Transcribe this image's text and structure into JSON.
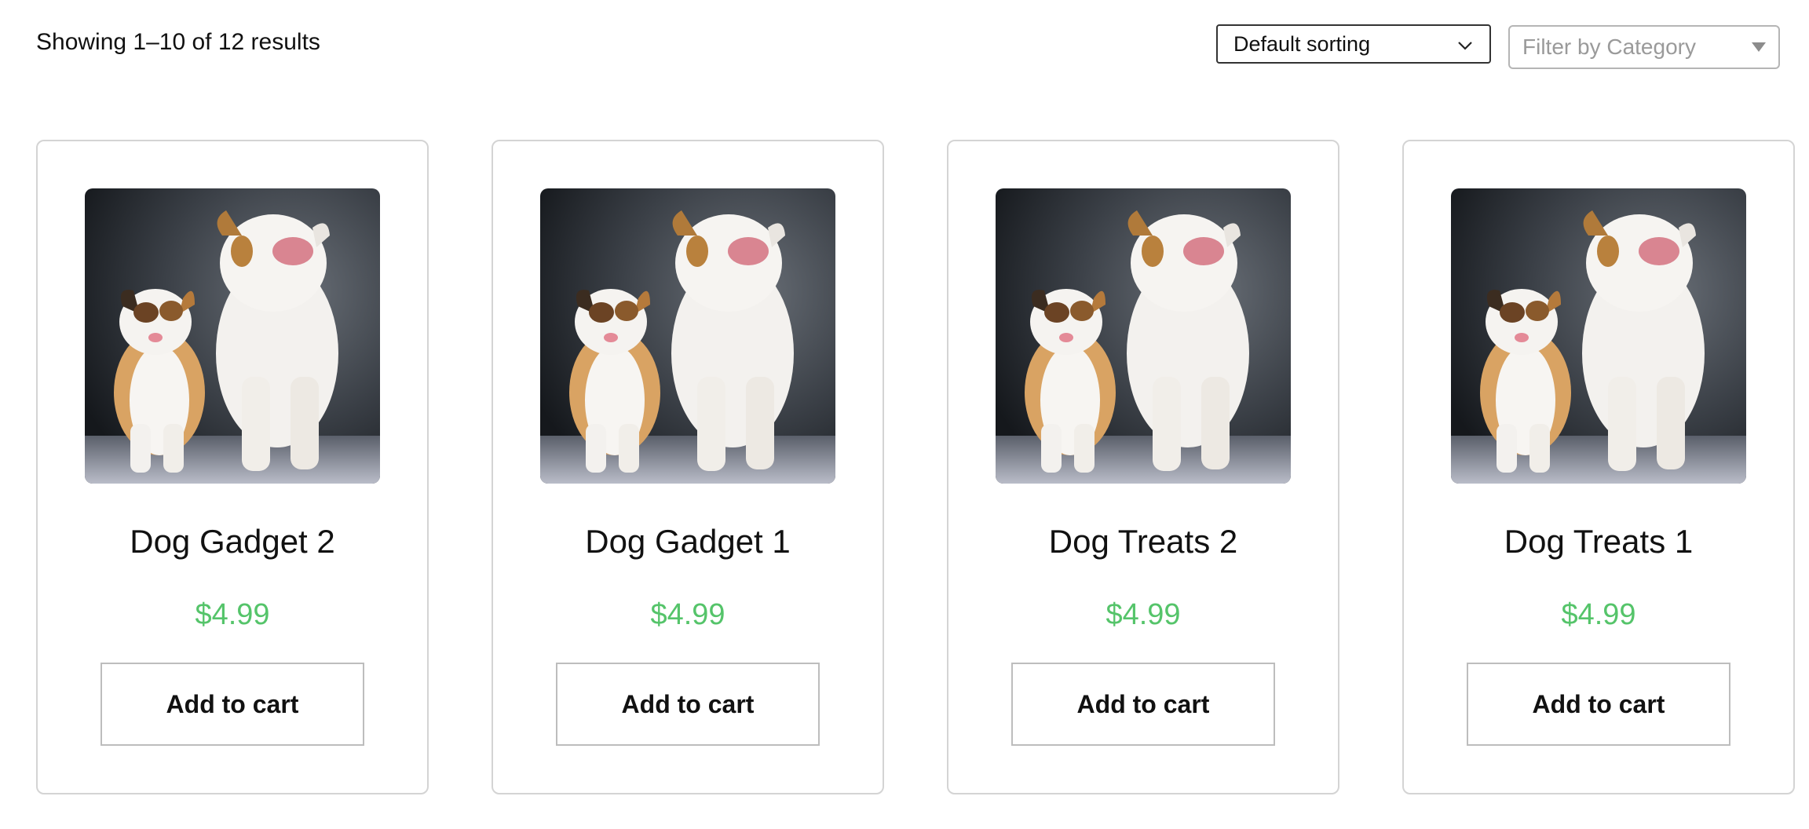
{
  "toolbar": {
    "result_count": "Showing 1–10 of 12 results",
    "sort": {
      "selected": "Default sorting",
      "icon": "chevron-down-icon"
    },
    "category_filter": {
      "placeholder": "Filter by Category",
      "icon": "caret-down-icon"
    }
  },
  "products": [
    {
      "name": "Dog Gadget 2",
      "price": "$4.99",
      "button_label": "Add to cart",
      "image": "two-bulldogs-photo"
    },
    {
      "name": "Dog Gadget 1",
      "price": "$4.99",
      "button_label": "Add to cart",
      "image": "two-bulldogs-photo"
    },
    {
      "name": "Dog Treats 2",
      "price": "$4.99",
      "button_label": "Add to cart",
      "image": "two-bulldogs-photo"
    },
    {
      "name": "Dog Treats 1",
      "price": "$4.99",
      "button_label": "Add to cart",
      "image": "two-bulldogs-photo"
    }
  ],
  "colors": {
    "price": "#55c46a",
    "card_border": "#d4d4d4",
    "button_border": "#bdbdbd"
  }
}
